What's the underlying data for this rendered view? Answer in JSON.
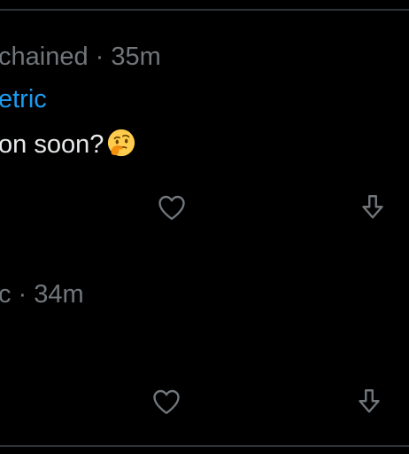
{
  "posts": [
    {
      "meta": "chained · 35m",
      "link_text": "etric",
      "body": "on soon?",
      "emoji": "thinking-face-emoji",
      "actions": {
        "like_icon": "heart-icon",
        "share_icon": "share-down-arrow-icon"
      }
    },
    {
      "meta": "c · 34m",
      "actions": {
        "like_icon": "heart-icon",
        "share_icon": "share-down-arrow-icon"
      }
    }
  ],
  "colors": {
    "background": "#000000",
    "text": "#e7e9ea",
    "muted": "#71767b",
    "link": "#1d9bf0",
    "divider": "#2f3336"
  }
}
